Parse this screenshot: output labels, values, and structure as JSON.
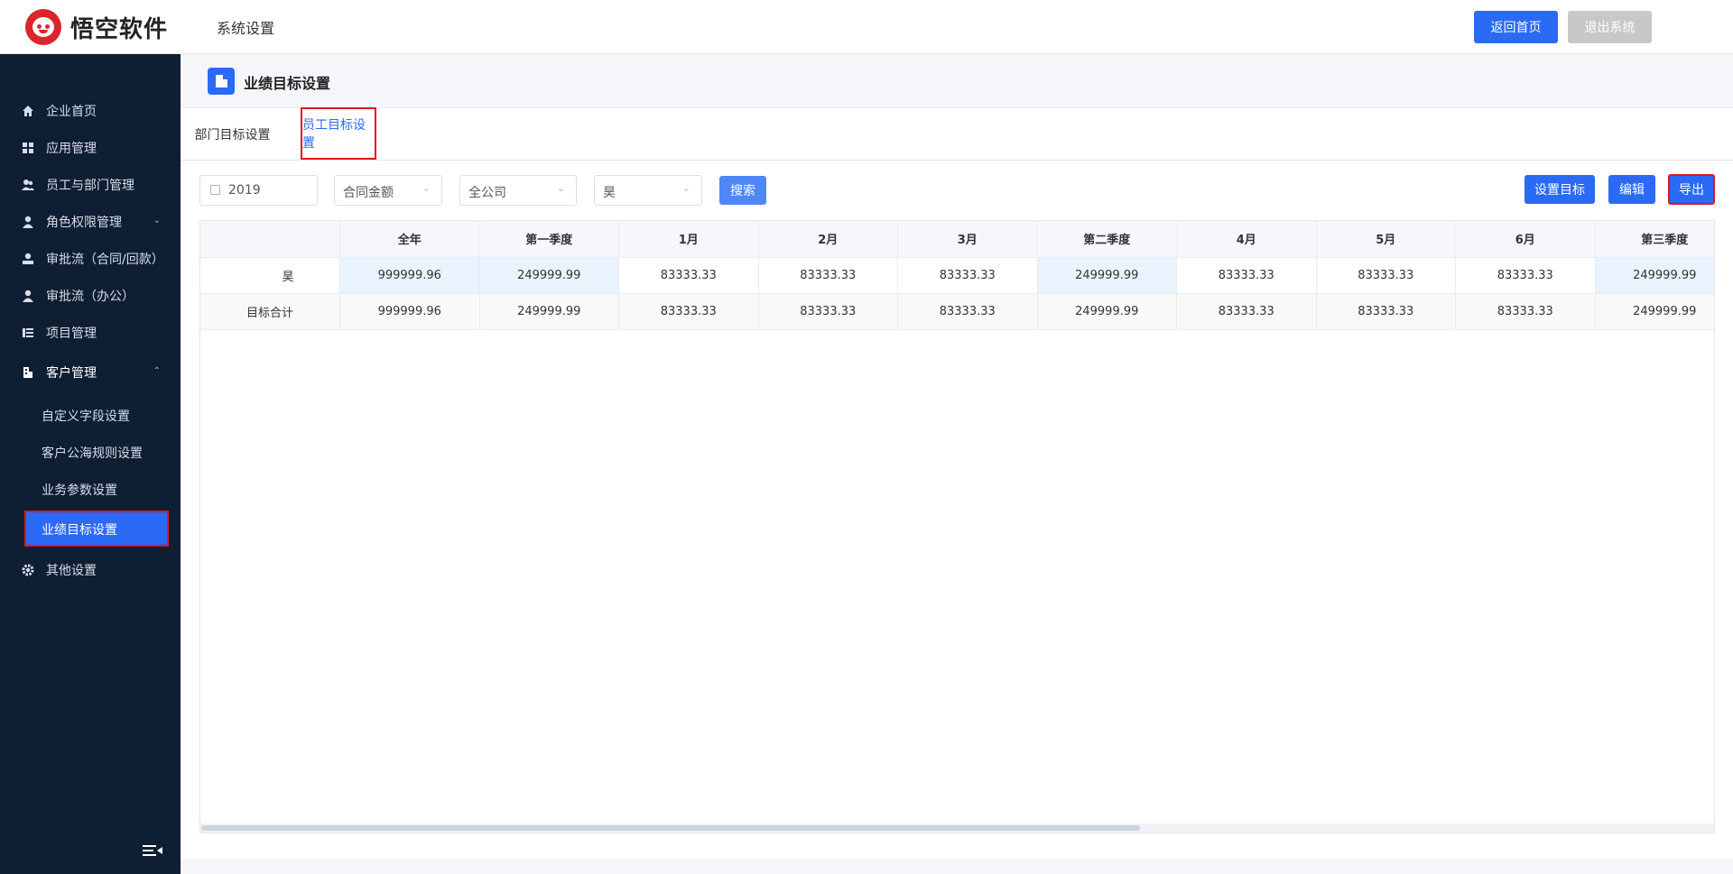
{
  "header": {
    "logo_text": "悟空软件",
    "title": "系统设置",
    "home_button": "返回首页",
    "logout_button": "退出系统"
  },
  "sidebar": {
    "items": [
      {
        "label": "企业首页",
        "icon": "home-icon"
      },
      {
        "label": "应用管理",
        "icon": "apps-grid-icon"
      },
      {
        "label": "员工与部门管理",
        "icon": "users-icon"
      },
      {
        "label": "角色权限管理",
        "icon": "user-role-icon",
        "chevron": "down"
      },
      {
        "label": "审批流（合同/回款）",
        "icon": "approval-icon"
      },
      {
        "label": "审批流（办公）",
        "icon": "approval-office-icon"
      },
      {
        "label": "项目管理",
        "icon": "project-list-icon"
      },
      {
        "label": "客户管理",
        "icon": "building-icon",
        "chevron": "up"
      }
    ],
    "sub_items": [
      "自定义字段设置",
      "客户公海规则设置",
      "业务参数设置",
      "业绩目标设置"
    ],
    "active_sub": "业绩目标设置",
    "other": {
      "label": "其他设置",
      "icon": "gear-icon"
    }
  },
  "page": {
    "title": "业绩目标设置",
    "tabs": [
      "部门目标设置",
      "员工目标设置"
    ],
    "active_tab": "员工目标设置"
  },
  "filters": {
    "year": "2019",
    "metric": "合同金额",
    "org": "全公司",
    "person": "昊",
    "search_button": "搜索"
  },
  "actions": {
    "set_target": "设置目标",
    "edit": "编辑",
    "export": "导出"
  },
  "table": {
    "columns": [
      "",
      "全年",
      "第一季度",
      "1月",
      "2月",
      "3月",
      "第二季度",
      "4月",
      "5月",
      "6月",
      "第三季度"
    ],
    "rows": [
      [
        "昊",
        "999999.96",
        "249999.99",
        "83333.33",
        "83333.33",
        "83333.33",
        "249999.99",
        "83333.33",
        "83333.33",
        "83333.33",
        "249999.99"
      ],
      [
        "目标合计",
        "999999.96",
        "249999.99",
        "83333.33",
        "83333.33",
        "83333.33",
        "249999.99",
        "83333.33",
        "83333.33",
        "83333.33",
        "249999.99"
      ]
    ]
  },
  "colors": {
    "primary": "#2a6af5",
    "sidebar_bg": "#0e1e33",
    "highlight_border": "#e0161f",
    "quarter_cell": "#e8f3fd"
  }
}
